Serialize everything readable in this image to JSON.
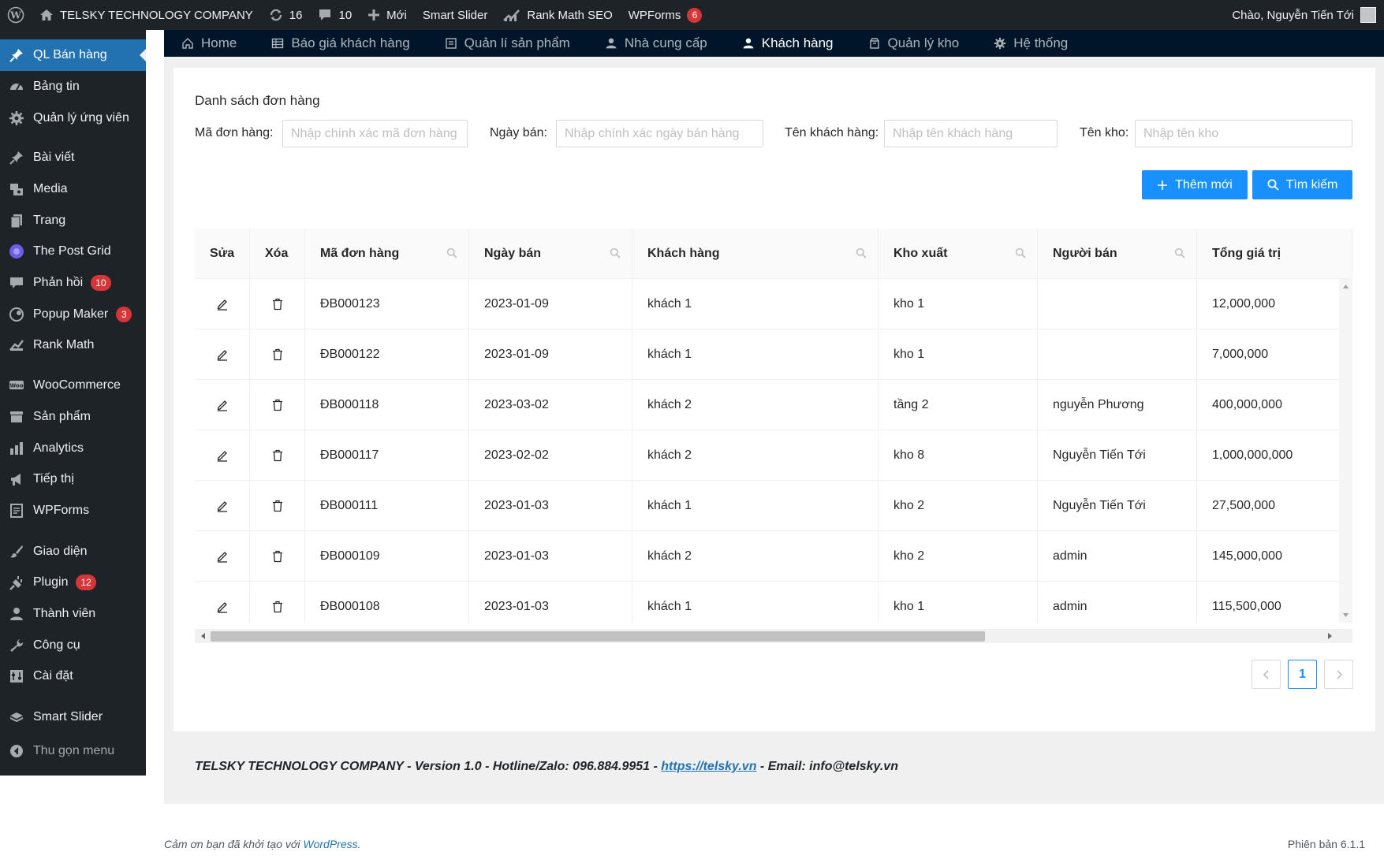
{
  "adminbar": {
    "site_name": "TELSKY TECHNOLOGY COMPANY",
    "updates": "16",
    "comments": "10",
    "new_label": "Mới",
    "smart_slider": "Smart Slider",
    "rank_math": "Rank Math SEO",
    "wpforms": "WPForms",
    "wpforms_badge": "6",
    "greeting": "Chào, Nguyễn Tiến Tới"
  },
  "sidebar": {
    "items": [
      {
        "label": "QL Bán hàng",
        "icon": "pin-icon",
        "current": true
      },
      {
        "label": "Bảng tin",
        "icon": "dashboard-icon"
      },
      {
        "label": "Quản lý ứng viên",
        "icon": "gear-icon"
      },
      {
        "label": "Bài viết",
        "icon": "pin-icon"
      },
      {
        "label": "Media",
        "icon": "media-icon"
      },
      {
        "label": "Trang",
        "icon": "page-icon"
      },
      {
        "label": "The Post Grid",
        "icon": "grid-logo-icon"
      },
      {
        "label": "Phản hồi",
        "icon": "comment-icon",
        "badge": "10"
      },
      {
        "label": "Popup Maker",
        "icon": "popup-icon",
        "badge": "3"
      },
      {
        "label": "Rank Math",
        "icon": "chart-icon"
      },
      {
        "label": "WooCommerce",
        "icon": "woo-icon"
      },
      {
        "label": "Sản phẩm",
        "icon": "archive-icon"
      },
      {
        "label": "Analytics",
        "icon": "bar-chart-icon"
      },
      {
        "label": "Tiếp thị",
        "icon": "megaphone-icon"
      },
      {
        "label": "WPForms",
        "icon": "form-icon"
      },
      {
        "label": "Giao diện",
        "icon": "brush-icon"
      },
      {
        "label": "Plugin",
        "icon": "plugin-icon",
        "badge": "12"
      },
      {
        "label": "Thành viên",
        "icon": "user-icon"
      },
      {
        "label": "Công cụ",
        "icon": "wrench-icon"
      },
      {
        "label": "Cài đặt",
        "icon": "settings-icon"
      },
      {
        "label": "Smart Slider",
        "icon": "slider-icon"
      },
      {
        "label": "Thu gọn menu",
        "icon": "collapse-icon"
      }
    ]
  },
  "topnav": [
    {
      "label": "Home",
      "icon": "home-icon"
    },
    {
      "label": "Báo giá khách hàng",
      "icon": "table-icon"
    },
    {
      "label": "Quản lí sản phẩm",
      "icon": "product-icon"
    },
    {
      "label": "Nhà cung cấp",
      "icon": "user-icon"
    },
    {
      "label": "Khách hàng",
      "icon": "user-icon",
      "active": true
    },
    {
      "label": "Quản lý kho",
      "icon": "box-icon"
    },
    {
      "label": "Hệ thống",
      "icon": "gear-icon"
    }
  ],
  "main": {
    "title": "Danh sách đơn hàng",
    "filters": {
      "order_label": "Mã đơn hàng:",
      "order_placeholder": "Nhập chính xác mã đơn hàng",
      "date_label": "Ngày bán:",
      "date_placeholder": "Nhập chính xác ngày bán hàng",
      "customer_label": "Tên khách hàng:",
      "customer_placeholder": "Nhập tên khách hàng",
      "warehouse_label": "Tên kho:",
      "warehouse_placeholder": "Nhập tên kho"
    },
    "add_button": "Thêm mới",
    "search_button": "Tìm kiếm",
    "pagination": {
      "current": "1"
    }
  },
  "table": {
    "headers": [
      "Sửa",
      "Xóa",
      "Mã đơn hàng",
      "Ngày bán",
      "Khách hàng",
      "Kho xuất",
      "Người bán",
      "Tổng giá trị"
    ],
    "rows": [
      {
        "code": "ĐB000123",
        "date": "2023-01-09",
        "customer": "khách 1",
        "warehouse": "kho 1",
        "seller": "",
        "total": "12,000,000"
      },
      {
        "code": "ĐB000122",
        "date": "2023-01-09",
        "customer": "khách 1",
        "warehouse": "kho 1",
        "seller": "",
        "total": "7,000,000"
      },
      {
        "code": "ĐB000118",
        "date": "2023-03-02",
        "customer": "khách 2",
        "warehouse": "tầng 2",
        "seller": "nguyễn Phương",
        "total": "400,000,000"
      },
      {
        "code": "ĐB000117",
        "date": "2023-02-02",
        "customer": "khách 2",
        "warehouse": "kho 8",
        "seller": "Nguyễn Tiến Tới",
        "total": "1,000,000,000"
      },
      {
        "code": "ĐB000111",
        "date": "2023-01-03",
        "customer": "khách 1",
        "warehouse": "kho 2",
        "seller": "Nguyễn Tiến Tới",
        "total": "27,500,000"
      },
      {
        "code": "ĐB000109",
        "date": "2023-01-03",
        "customer": "khách 2",
        "warehouse": "kho 2",
        "seller": "admin",
        "total": "145,000,000"
      },
      {
        "code": "ĐB000108",
        "date": "2023-01-03",
        "customer": "khách 1",
        "warehouse": "kho 1",
        "seller": "admin",
        "total": "115,500,000"
      }
    ]
  },
  "footer": {
    "company": "TELSKY TECHNOLOGY COMPANY - Version 1.0 - Hotline/Zalo: 096.884.9951 - ",
    "link": "https://telsky.vn",
    "email": " - Email: info@telsky.vn",
    "thanks_prefix": "Cảm ơn bạn đã khởi tạo với ",
    "thanks_link": "WordPress",
    "thanks_suffix": ".",
    "version": "Phiên bản 6.1.1"
  },
  "colors": {
    "primary": "#1890ff",
    "admin_dark": "#1d2327",
    "nav_dark": "#001529",
    "wp_blue": "#2271b1",
    "badge_red": "#d63638"
  }
}
